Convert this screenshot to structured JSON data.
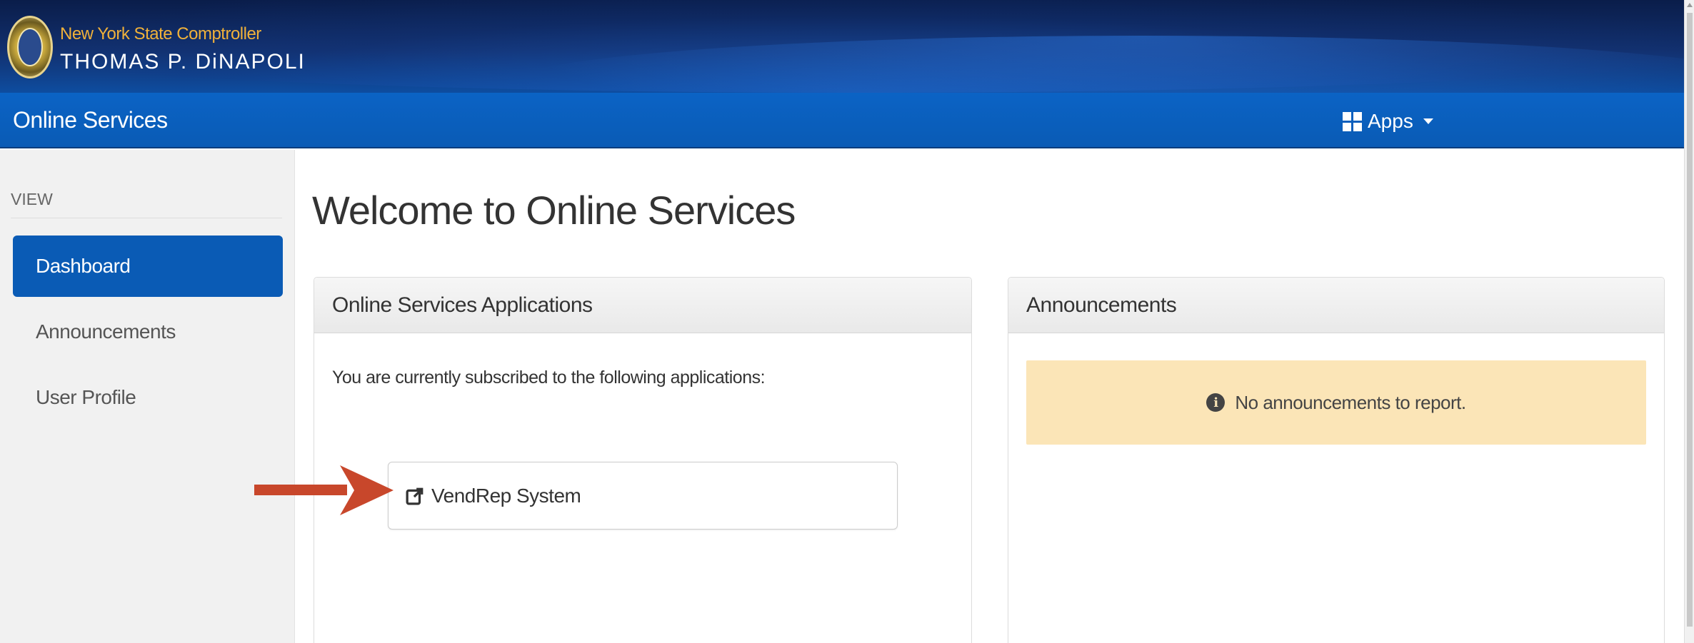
{
  "header": {
    "org_line1": "New York State Comptroller",
    "org_line2": "THOMAS P. DiNAPOLI",
    "seal_icon": "nys-seal-icon"
  },
  "navbar": {
    "title": "Online Services",
    "apps_label": "Apps",
    "apps_icon": "grid-icon",
    "color": "#0a5bb5"
  },
  "sidebar": {
    "section_label": "VIEW",
    "items": [
      {
        "label": "Dashboard",
        "active": true
      },
      {
        "label": "Announcements",
        "active": false
      },
      {
        "label": "User Profile",
        "active": false
      }
    ]
  },
  "main": {
    "title": "Welcome to Online Services",
    "applications_panel": {
      "heading": "Online Services Applications",
      "subscribed_text": "You are currently subscribed to the following applications:",
      "apps": [
        {
          "label": "VendRep System",
          "icon": "external-link-icon"
        }
      ]
    },
    "announcements_panel": {
      "heading": "Announcements",
      "message": "No announcements to report.",
      "message_icon": "info-icon",
      "message_bg": "#fbe5b7"
    }
  },
  "annotation": {
    "arrow_color": "#c8472b"
  }
}
